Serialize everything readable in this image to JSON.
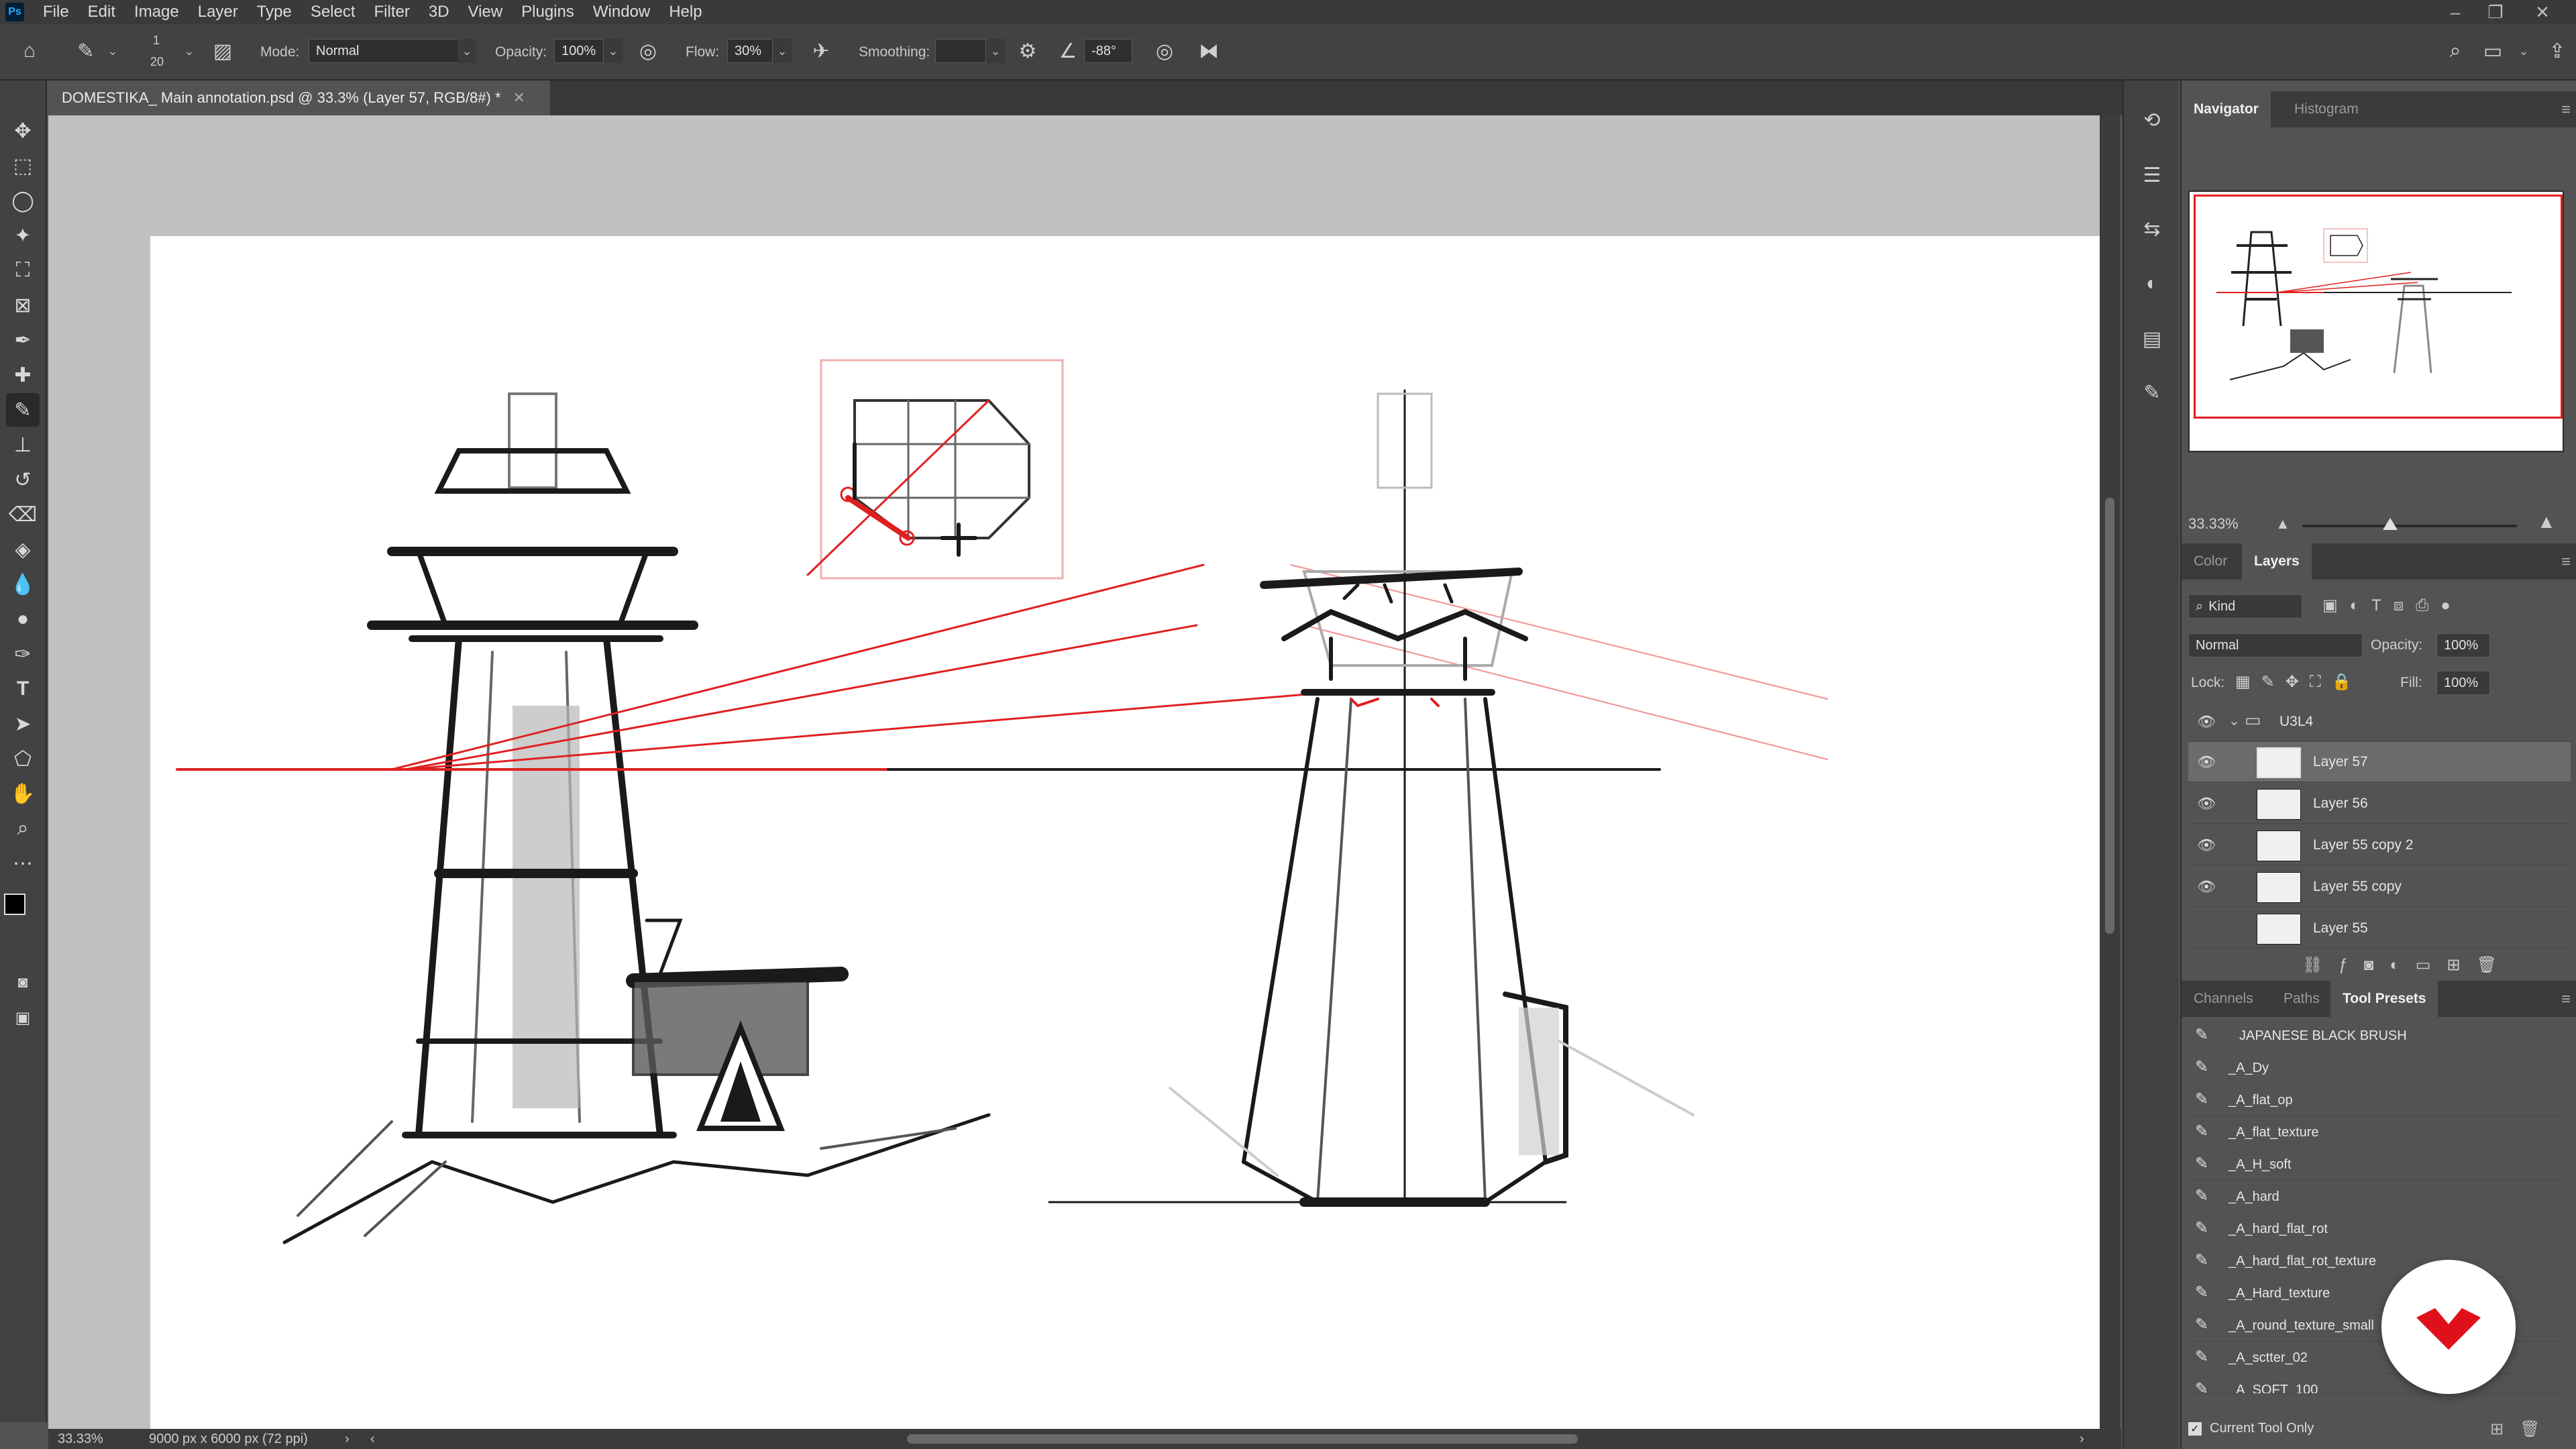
{
  "menu": [
    "File",
    "Edit",
    "Image",
    "Layer",
    "Type",
    "Select",
    "Filter",
    "3D",
    "View",
    "Plugins",
    "Window",
    "Help"
  ],
  "app_logo": "Ps",
  "options": {
    "brush_size": "20",
    "brush_size_top": "1",
    "mode_label": "Mode:",
    "mode_value": "Normal",
    "opacity_label": "Opacity:",
    "opacity_value": "100%",
    "flow_label": "Flow:",
    "flow_value": "30%",
    "smoothing_label": "Smoothing:",
    "smoothing_value": "",
    "angle_value": "-88°"
  },
  "document": {
    "tab_title": "DOMESTIKA_ Main annotation.psd @ 33.3% (Layer 57, RGB/8#) *"
  },
  "status": {
    "zoom": "33.33%",
    "doc_size": "9000 px x 6000 px (72 ppi)"
  },
  "navigator": {
    "tabs": [
      "Navigator",
      "Histogram"
    ],
    "zoom": "33.33%"
  },
  "layers_panel": {
    "tabs": [
      "Color",
      "Layers"
    ],
    "filter_kind": "Kind",
    "blend_mode": "Normal",
    "opacity_label": "Opacity:",
    "opacity_value": "100%",
    "lock_label": "Lock:",
    "fill_label": "Fill:",
    "fill_value": "100%",
    "group_name": "U3L4",
    "layers": [
      {
        "name": "Layer 57",
        "visible": true,
        "selected": true
      },
      {
        "name": "Layer 56",
        "visible": true,
        "selected": false
      },
      {
        "name": "Layer 55 copy 2",
        "visible": true,
        "selected": false
      },
      {
        "name": "Layer 55 copy",
        "visible": true,
        "selected": false
      },
      {
        "name": "Layer 55",
        "visible": false,
        "selected": false
      }
    ]
  },
  "bottom_panel": {
    "tabs": [
      "Channels",
      "Paths",
      "Tool Presets"
    ],
    "presets": [
      "JAPANESE BLACK BRUSH",
      "_A_Dy",
      "_A_flat_op",
      "_A_flat_texture",
      "_A_H_soft",
      "_A_hard",
      "_A_hard_flat_rot",
      "_A_hard_flat_rot_texture",
      "_A_Hard_texture",
      "_A_round_texture_small",
      "_A_sctter_02",
      "_A_SOFT_100"
    ],
    "current_tool_only": "Current Tool Only"
  },
  "colors": {
    "foreground": "#000000",
    "background": "#e01010",
    "accent_red": "#e02020"
  }
}
